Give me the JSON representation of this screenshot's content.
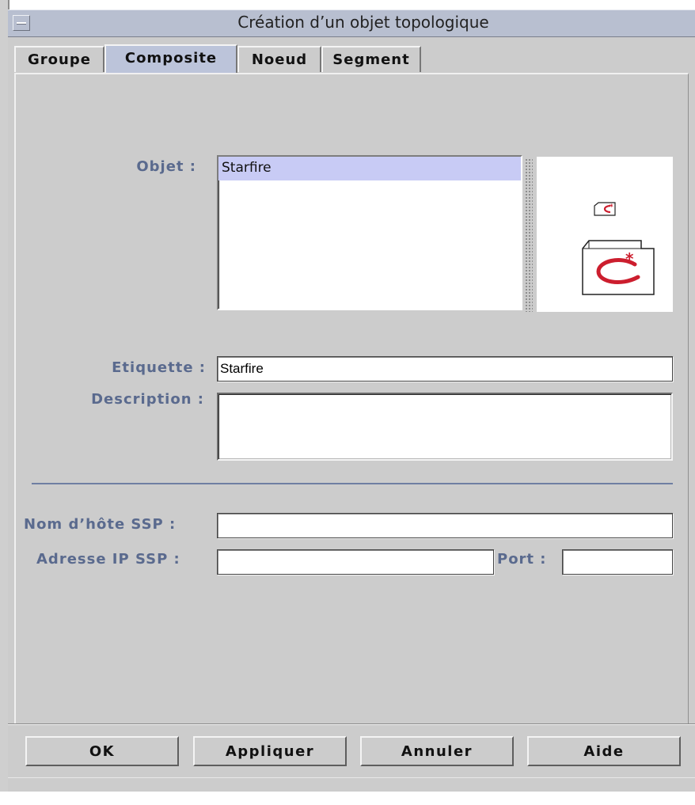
{
  "window": {
    "title": "Création d’un objet topologique"
  },
  "tabs": [
    {
      "label": "Groupe",
      "selected": false
    },
    {
      "label": "Composite",
      "selected": true
    },
    {
      "label": "Noeud",
      "selected": false
    },
    {
      "label": "Segment",
      "selected": false
    }
  ],
  "form": {
    "objet_label": "Objet :",
    "objet_list": [
      {
        "label": "Starfire",
        "selected": true
      }
    ],
    "etiquette_label": "Etiquette :",
    "etiquette_value": "Starfire",
    "description_label": "Description :",
    "description_value": "",
    "hostname_label": "Nom d’hôte SSP :",
    "hostname_value": "",
    "ip_label": "Adresse IP SSP :",
    "ip_value": "",
    "port_label": "Port :",
    "port_value": ""
  },
  "icons": {
    "preview_small": "starfire-folder-icon-small",
    "preview_large": "starfire-folder-icon-large",
    "logo_color": "#cc1e2e"
  },
  "buttons": {
    "ok": "OK",
    "apply": "Appliquer",
    "cancel": "Annuler",
    "help": "Aide"
  }
}
